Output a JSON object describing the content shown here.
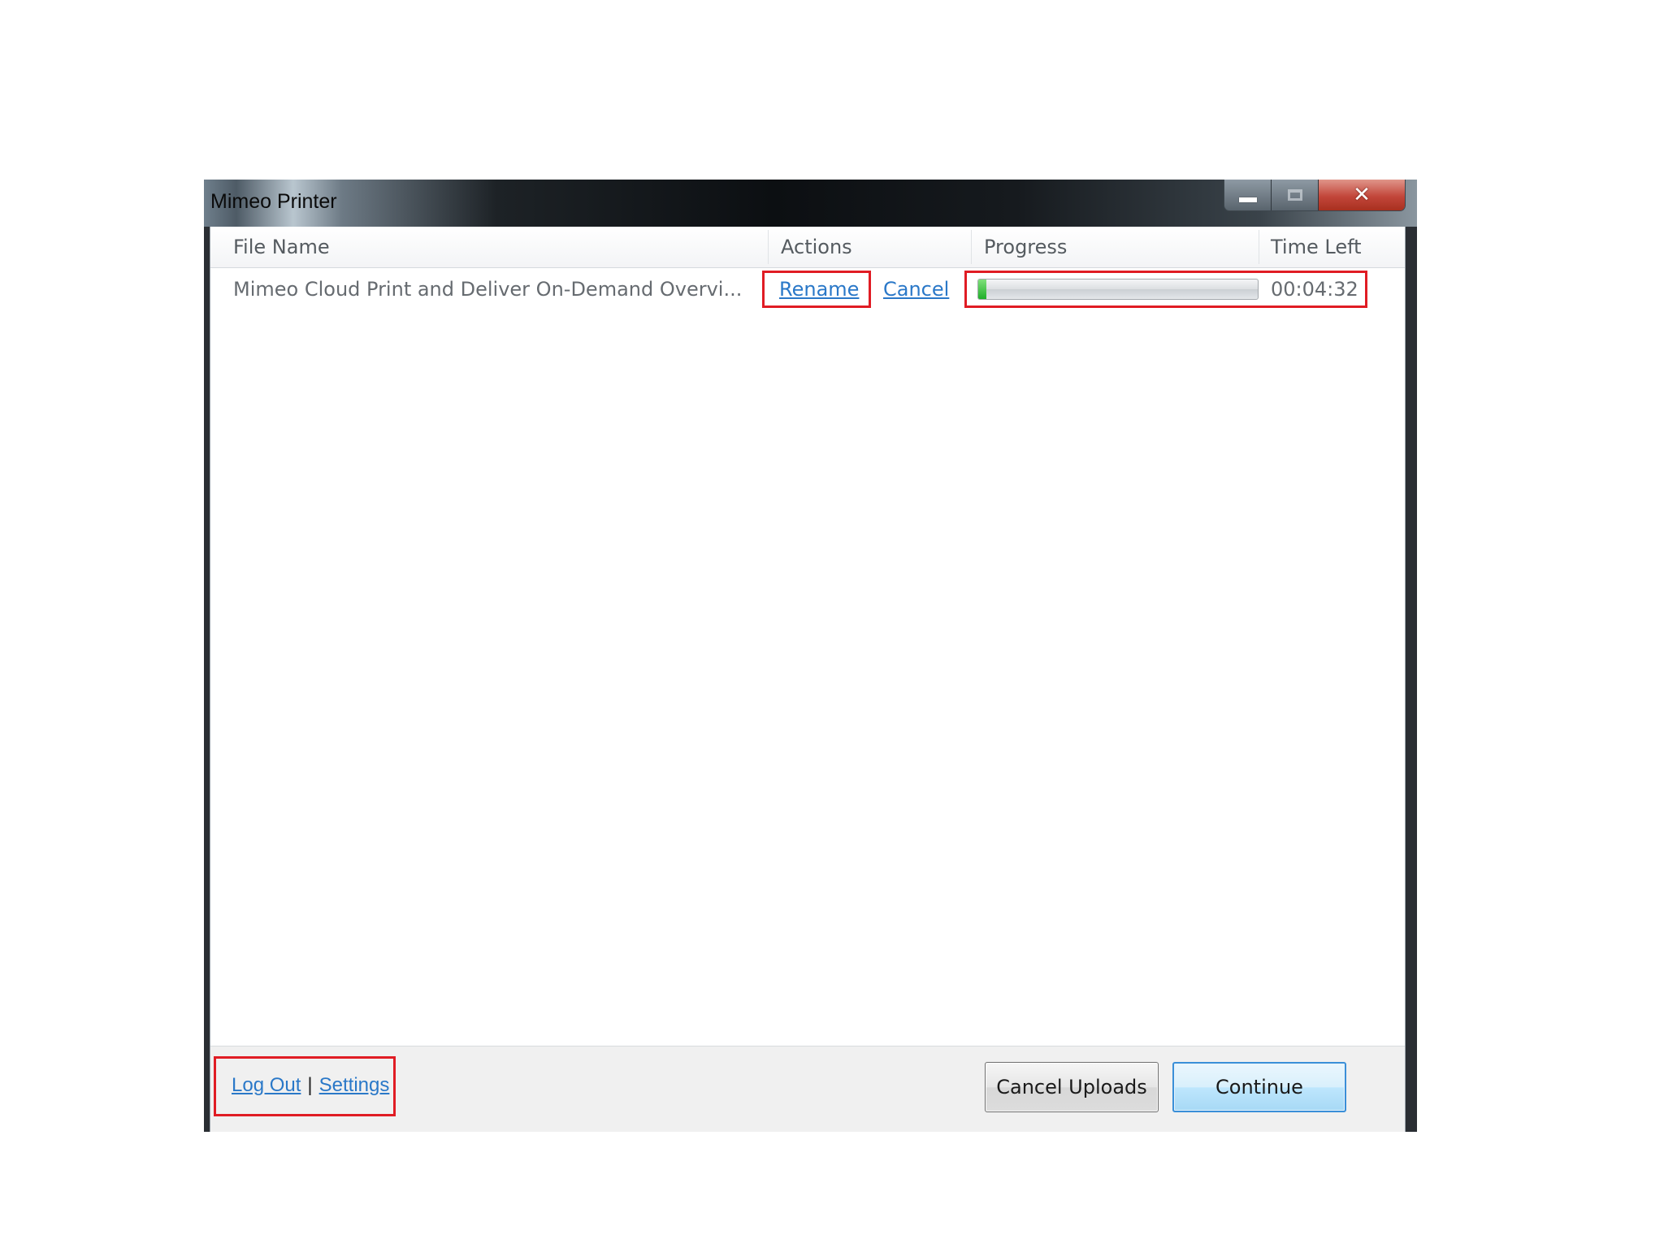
{
  "window": {
    "title": "Mimeo Printer",
    "close_glyph": "✕"
  },
  "columns": {
    "file_name": "File Name",
    "actions": "Actions",
    "progress": "Progress",
    "time_left": "Time Left"
  },
  "uploads": [
    {
      "file_name": "Mimeo Cloud Print and Deliver On-Demand Overvi...",
      "rename_label": "Rename",
      "cancel_label": "Cancel",
      "progress_fraction": 0.03,
      "time_left": "00:04:32"
    }
  ],
  "footer": {
    "logout_label": "Log Out",
    "separator": "|",
    "settings_label": "Settings",
    "cancel_uploads_label": "Cancel Uploads",
    "continue_label": "Continue"
  },
  "colors": {
    "highlight": "#e01c24",
    "link": "#2a78c8",
    "progress_fill": "#1fae2a"
  },
  "icons": {
    "minimize": "minimize-icon",
    "maximize": "maximize-icon",
    "close": "close-icon"
  }
}
